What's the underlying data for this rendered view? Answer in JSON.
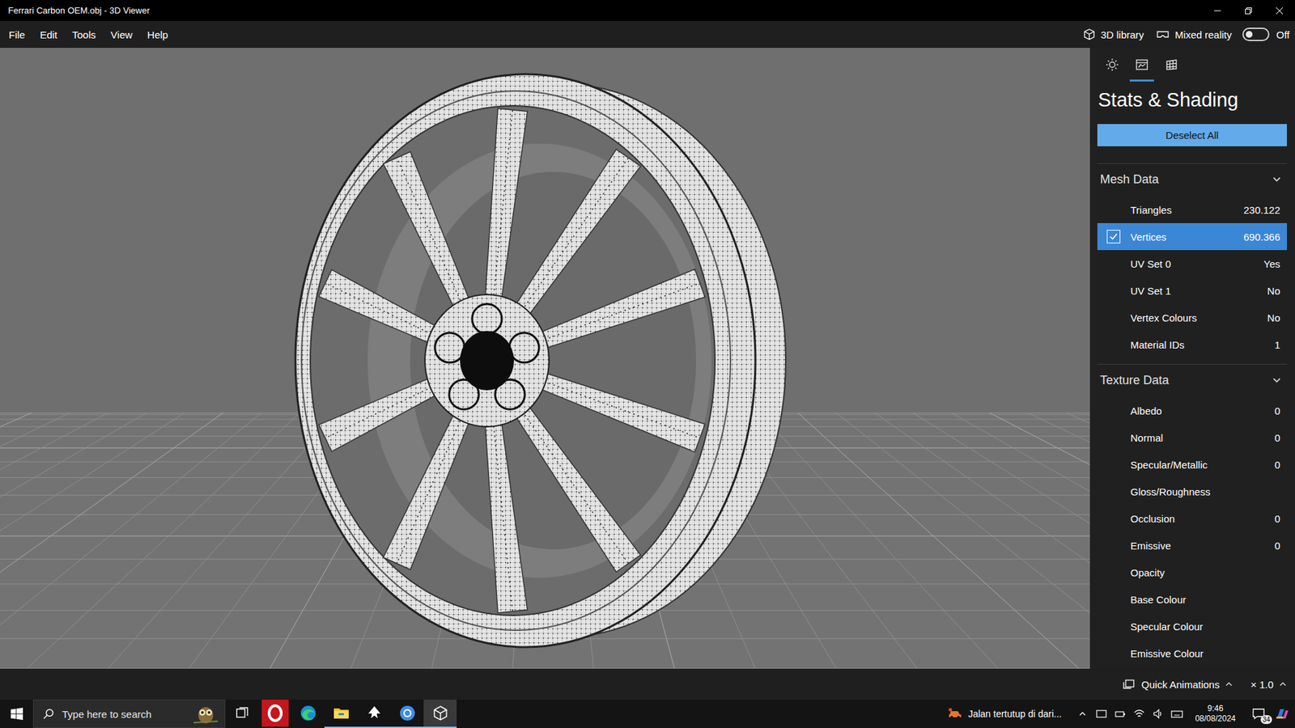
{
  "window": {
    "title": "Ferrari Carbon OEM.obj - 3D Viewer"
  },
  "menu": [
    "File",
    "Edit",
    "Tools",
    "View",
    "Help"
  ],
  "toolbar": {
    "library": "3D library",
    "mixed_reality": {
      "label": "Mixed reality",
      "on": false,
      "state": "Off"
    }
  },
  "panel": {
    "tabs": [
      {
        "kind": "lighting",
        "selected": false
      },
      {
        "kind": "stats",
        "selected": true
      },
      {
        "kind": "grid",
        "selected": false
      }
    ],
    "title": "Stats & Shading",
    "deselect_button": "Deselect All",
    "sections": [
      {
        "title": "Mesh Data",
        "expanded": true,
        "rows": [
          {
            "label": "Triangles",
            "value": "230.122",
            "checked": false,
            "selected": false
          },
          {
            "label": "Vertices",
            "value": "690.366",
            "checked": true,
            "selected": true
          },
          {
            "label": "UV Set 0",
            "value": "Yes",
            "checked": false,
            "selected": false
          },
          {
            "label": "UV Set 1",
            "value": "No",
            "checked": false,
            "selected": false
          },
          {
            "label": "Vertex Colours",
            "value": "No",
            "checked": false,
            "selected": false
          },
          {
            "label": "Material IDs",
            "value": "1",
            "checked": false,
            "selected": false
          }
        ]
      },
      {
        "title": "Texture Data",
        "expanded": true,
        "rows": [
          {
            "label": "Albedo",
            "value": "0",
            "checked": false,
            "selected": false
          },
          {
            "label": "Normal",
            "value": "0",
            "checked": false,
            "selected": false
          },
          {
            "label": "Specular/Metallic",
            "value": "0",
            "checked": false,
            "selected": false
          },
          {
            "label": "Gloss/Roughness",
            "checked": false,
            "selected": false
          },
          {
            "label": "Occlusion",
            "value": "0",
            "checked": false,
            "selected": false
          },
          {
            "label": "Emissive",
            "value": "0",
            "checked": false,
            "selected": false
          },
          {
            "label": "Opacity",
            "checked": false,
            "selected": false
          },
          {
            "label": "Base Colour",
            "checked": false,
            "selected": false
          },
          {
            "label": "Specular Colour",
            "checked": false,
            "selected": false
          },
          {
            "label": "Emissive Colour",
            "checked": false,
            "selected": false
          }
        ]
      }
    ]
  },
  "bottom_bar": {
    "quick_animations": "Quick Animations",
    "speed": "× 1.0"
  },
  "taskbar": {
    "search_placeholder": "Type here to search",
    "apps": [
      {
        "kind": "task-view",
        "running": false,
        "active": false
      },
      {
        "kind": "opera",
        "running": false,
        "active": false
      },
      {
        "kind": "edge",
        "running": false,
        "active": false
      },
      {
        "kind": "explorer",
        "running": true,
        "active": false
      },
      {
        "kind": "inkscape",
        "running": true,
        "active": false
      },
      {
        "kind": "chrome",
        "running": true,
        "active": false
      },
      {
        "kind": "3d-viewer",
        "running": true,
        "active": true
      }
    ],
    "notification": "Jalan tertutup di dari...",
    "time": "9:46",
    "date": "08/08/2024",
    "badge": "34"
  }
}
